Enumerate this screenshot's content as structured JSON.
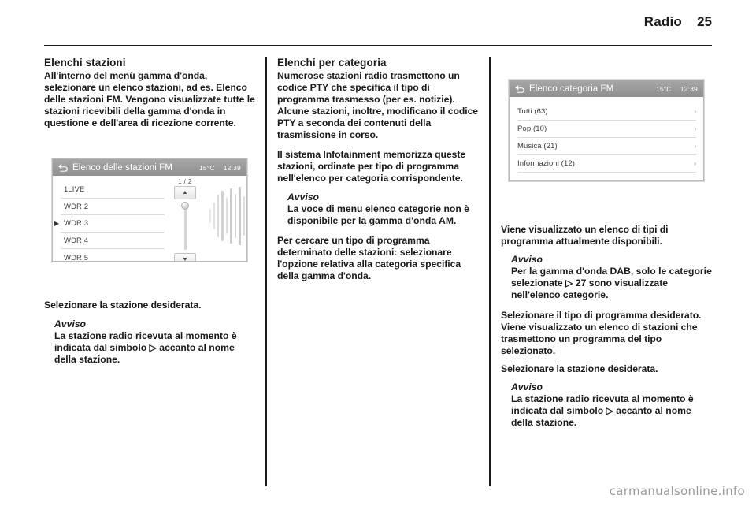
{
  "header": {
    "title": "Radio",
    "page_number": "25"
  },
  "footer": {
    "watermark": "carmanualsonline.info"
  },
  "columns": {
    "left": {
      "section_title": "Elenchi stazioni",
      "intro": "All'interno del menù gamma d'onda, selezionare un elenco stazioni, ad es. Elenco delle stazioni FM. Vengono visualizzate tutte le stazioni ricevibili della gamma d'onda in questione e dell'area di ricezione corrente.",
      "after_figure": "Selezionare la stazione desiderata.",
      "notice_title": "Avviso",
      "notice_text": "La stazione radio ricevuta al momento è indicata dal simbolo ▷ accanto al nome della stazione."
    },
    "middle": {
      "section_title": "Elenchi per categoria",
      "para1": "Numerose stazioni radio trasmettono un codice PTY che specifica il tipo di programma trasmesso (per es. notizie). Alcune stazioni, inoltre, modificano il codice PTY a seconda dei contenuti della trasmissione in corso.",
      "para2": "Il sistema Infotainment memorizza queste stazioni, ordinate per tipo di programma nell'elenco per categoria corrispondente.",
      "notice_title": "Avviso",
      "notice_text": "La voce di menu elenco categorie non è disponibile per la gamma d'onda AM.",
      "para3": "Per cercare un tipo di programma determinato delle stazioni: selezionare l'opzione relativa alla categoria specifica della gamma d'onda."
    },
    "right": {
      "after_figure": "Viene visualizzato un elenco di tipi di programma attualmente disponibili.",
      "notice1_title": "Avviso",
      "notice1_text": "Per la gamma d'onda DAB, solo le categorie selezionate ▷ 27 sono visualizzate nell'elenco categorie.",
      "para1": "Selezionare il tipo di programma desiderato. Viene visualizzato un elenco di stazioni che trasmettono un programma del tipo selezionato.",
      "para2": "Selezionare la stazione desiderata.",
      "notice2_title": "Avviso",
      "notice2_text": "La stazione radio ricevuta al momento è indicata dal simbolo ▷ accanto al nome della stazione."
    }
  },
  "figure_station_list": {
    "back_icon": "back-arrow-icon",
    "title": "Elenco delle stazioni FM",
    "temperature": "15°C",
    "clock": "12:39",
    "page_indicator": "1 / 2",
    "scroll_up_icon": "▲",
    "scroll_down_icon": "▼",
    "stations": [
      {
        "name": "1LIVE",
        "playing": false
      },
      {
        "name": "WDR 2",
        "playing": false
      },
      {
        "name": "WDR 3",
        "playing": true
      },
      {
        "name": "WDR 4",
        "playing": false
      },
      {
        "name": "WDR 5",
        "playing": false
      }
    ]
  },
  "figure_category_list": {
    "back_icon": "back-arrow-icon",
    "title": "Elenco categoria FM",
    "temperature": "15°C",
    "clock": "12:39",
    "chevron": "›",
    "categories": [
      {
        "label": "Tutti (63)"
      },
      {
        "label": "Pop (10)"
      },
      {
        "label": "Musica (21)"
      },
      {
        "label": "Informazioni (12)"
      }
    ]
  }
}
